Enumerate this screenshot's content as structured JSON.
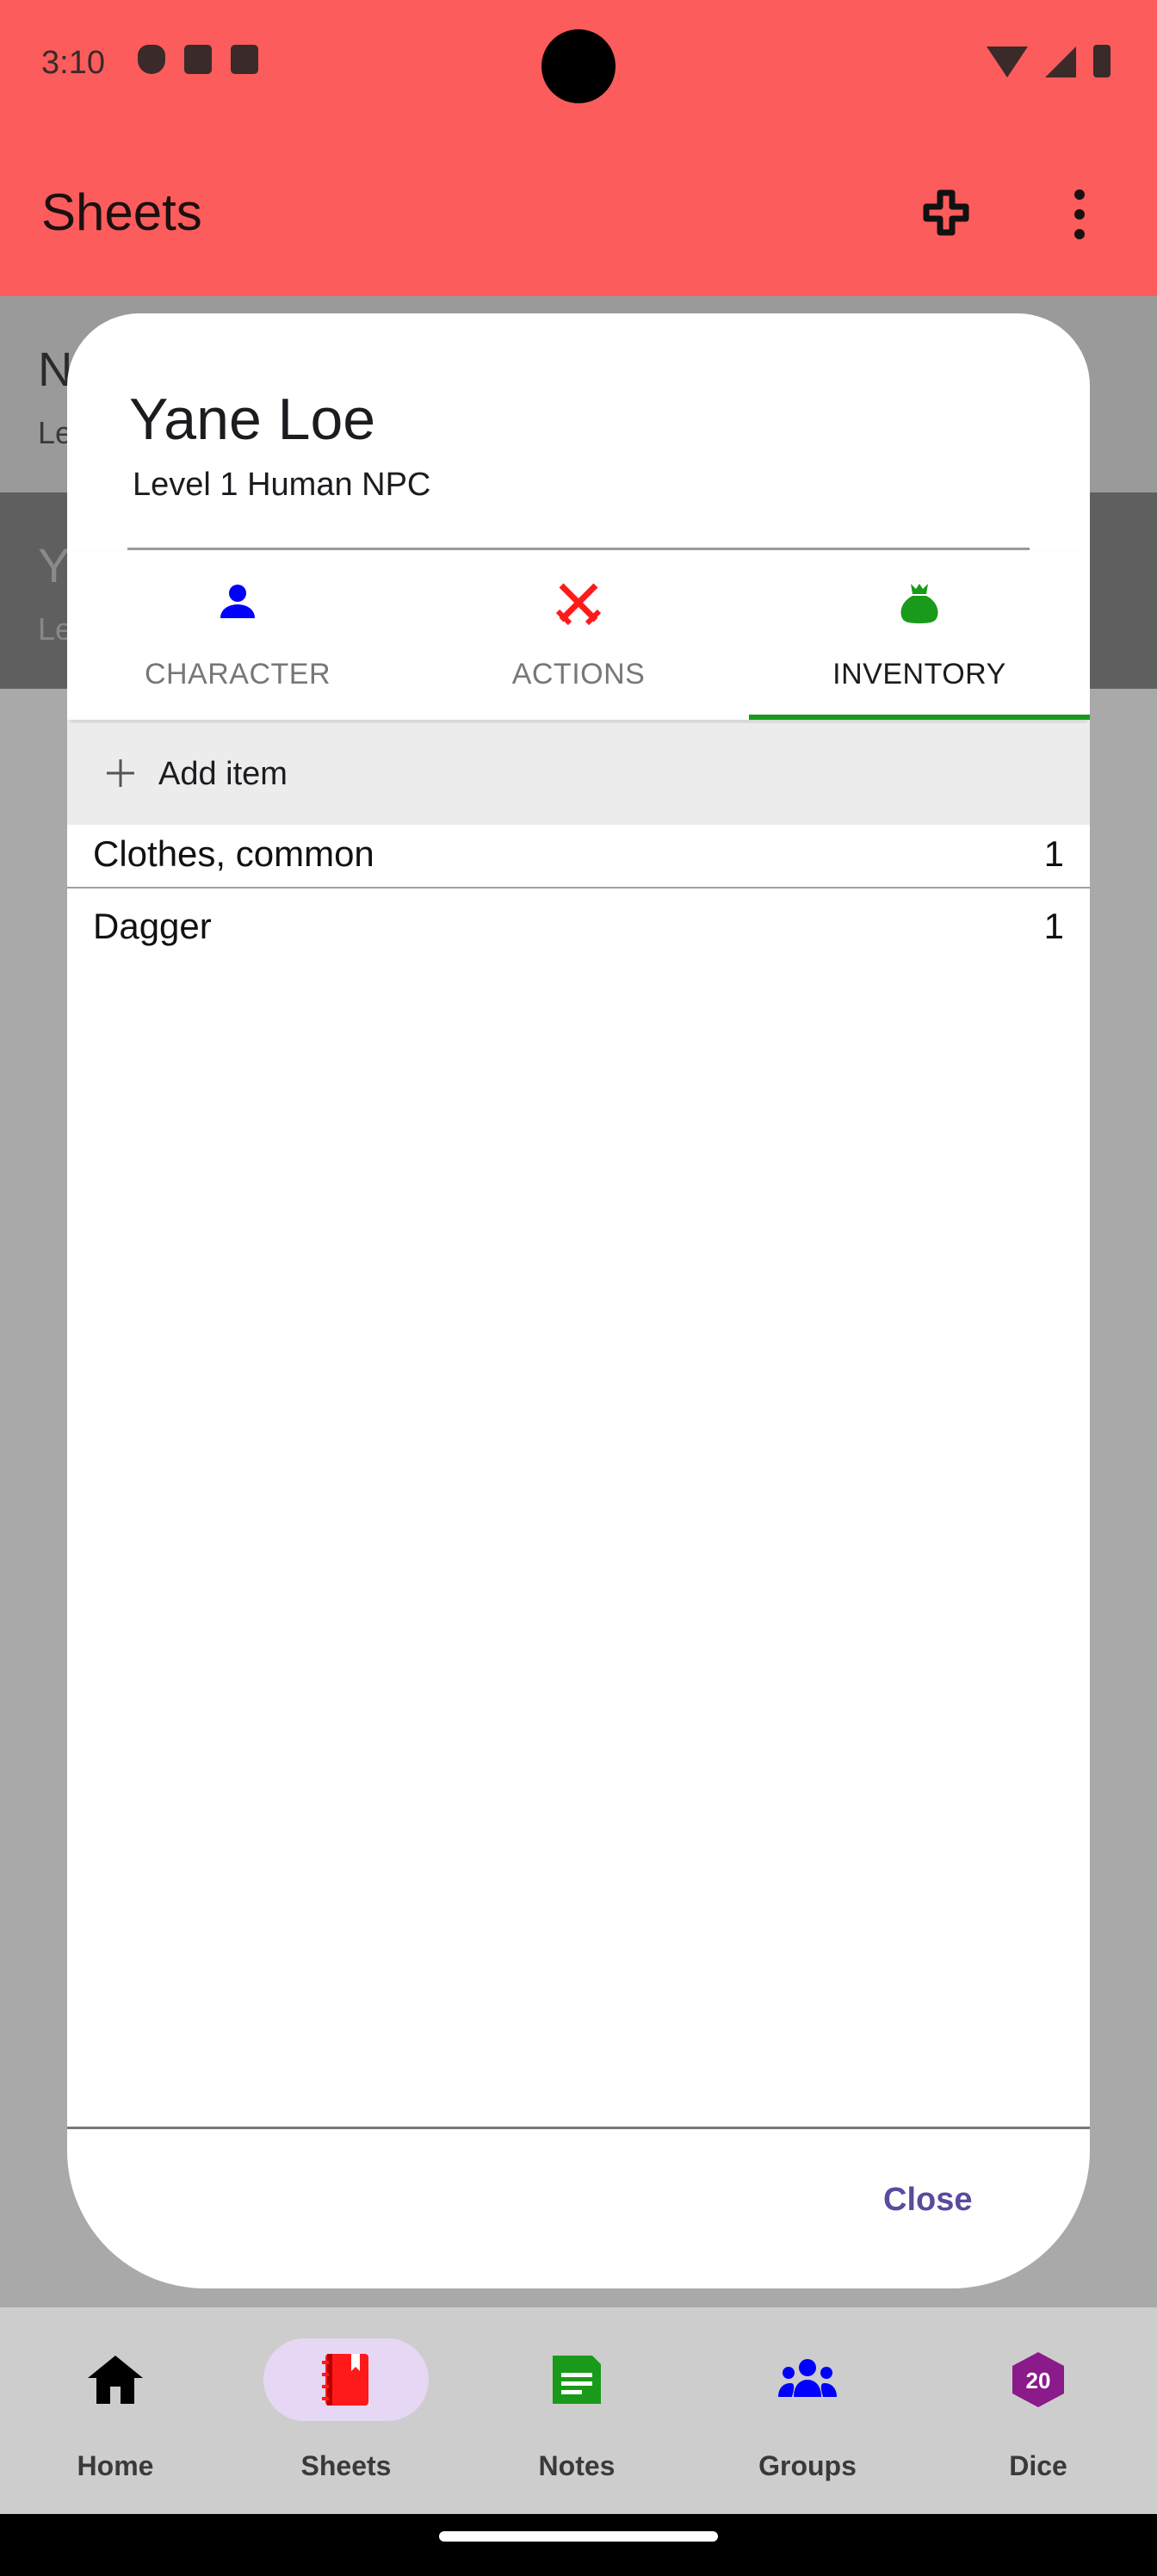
{
  "status": {
    "time": "3:10"
  },
  "appbar": {
    "title": "Sheets"
  },
  "background_list": [
    {
      "title": "N",
      "subtitle": "Le"
    },
    {
      "title": "Y",
      "subtitle": "Le"
    }
  ],
  "dialog": {
    "title": "Yane Loe",
    "subtitle": "Level 1 Human NPC",
    "tabs": [
      {
        "label": "CHARACTER",
        "icon": "person-icon",
        "color": "#0000ff"
      },
      {
        "label": "ACTIONS",
        "icon": "crossed-swords-icon",
        "color": "#ff0000"
      },
      {
        "label": "INVENTORY",
        "icon": "bag-icon",
        "color": "#1a9a1a",
        "active": true
      }
    ],
    "add_item_label": "Add item",
    "items": [
      {
        "name": "Clothes, common",
        "qty": "1"
      },
      {
        "name": "Dagger",
        "qty": "1"
      }
    ],
    "close_label": "Close"
  },
  "nav": {
    "items": [
      {
        "label": "Home",
        "icon": "home-icon",
        "color": "#000000"
      },
      {
        "label": "Sheets",
        "icon": "sheets-book-icon",
        "color": "#ff0000",
        "active": true
      },
      {
        "label": "Notes",
        "icon": "notes-icon",
        "color": "#1a9a1a"
      },
      {
        "label": "Groups",
        "icon": "groups-icon",
        "color": "#0000ff"
      },
      {
        "label": "Dice",
        "icon": "d20-icon",
        "color": "#8b1a8b",
        "badge": "20"
      }
    ]
  }
}
